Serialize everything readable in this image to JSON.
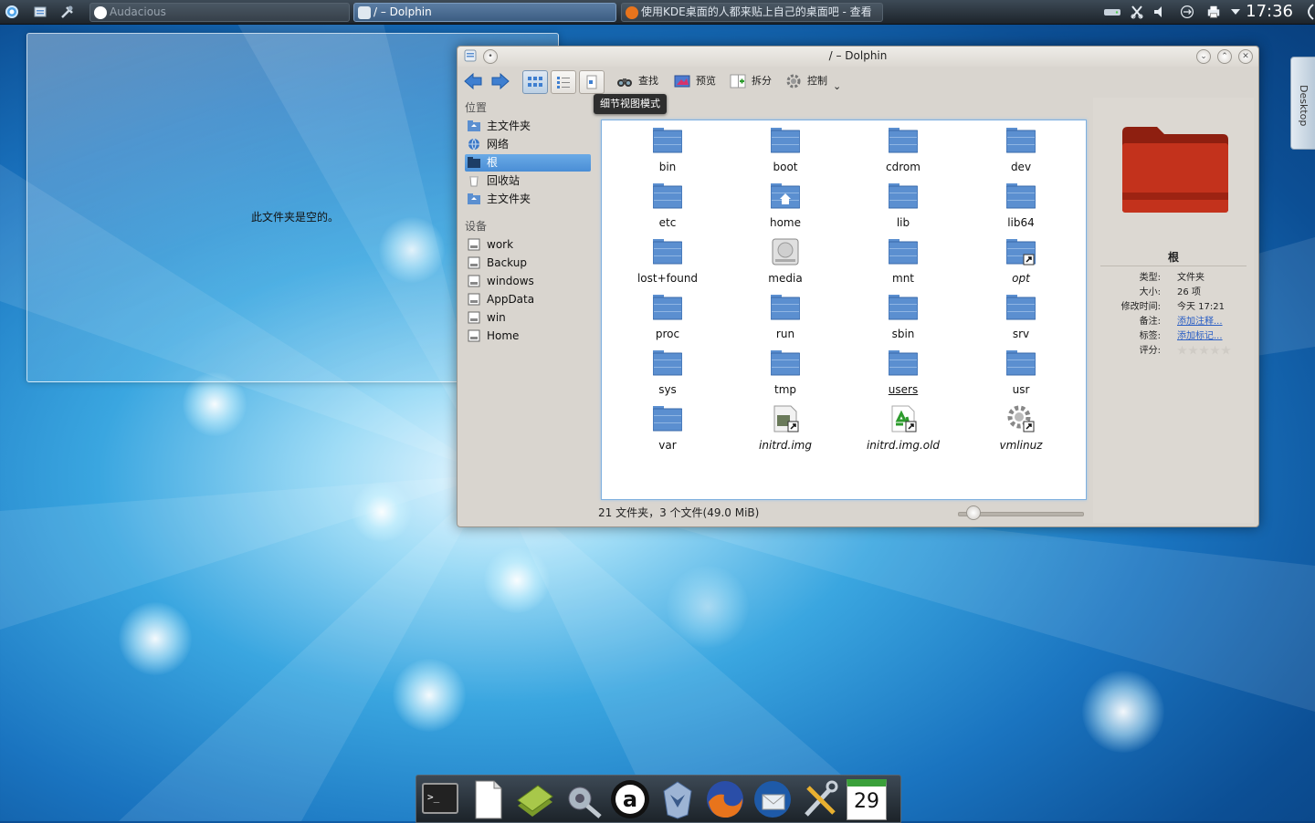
{
  "top_panel": {
    "tasks": [
      {
        "label": "Audacious",
        "icon": "audacious-icon",
        "state": "inactive"
      },
      {
        "label": "/ – Dolphin",
        "icon": "dolphin-icon",
        "state": "active"
      },
      {
        "label": "使用KDE桌面的人都来贴上自己的桌面吧 - 查看",
        "icon": "firefox-icon",
        "state": "inactive"
      }
    ],
    "clock": "17:36"
  },
  "empty_window": {
    "message": "此文件夹是空的。"
  },
  "dolphin": {
    "title": "/ – Dolphin",
    "toolbar": {
      "find_label": "查找",
      "preview_label": "预览",
      "split_label": "拆分",
      "control_label": "控制"
    },
    "tooltip": "细节视图模式",
    "places": {
      "section_places": "位置",
      "places_items": [
        {
          "label": "主文件夹",
          "icon": "home-folder-icon"
        },
        {
          "label": "网络",
          "icon": "network-icon"
        },
        {
          "label": "根",
          "icon": "root-folder-icon",
          "selected": true
        },
        {
          "label": "回收站",
          "icon": "trash-icon"
        },
        {
          "label": "主文件夹",
          "icon": "home-folder-icon"
        }
      ],
      "section_devices": "设备",
      "devices": [
        {
          "label": "work",
          "icon": "drive-icon"
        },
        {
          "label": "Backup",
          "icon": "drive-icon"
        },
        {
          "label": "windows",
          "icon": "drive-icon"
        },
        {
          "label": "AppData",
          "icon": "drive-icon"
        },
        {
          "label": "win",
          "icon": "drive-icon"
        },
        {
          "label": "Home",
          "icon": "drive-icon"
        }
      ]
    },
    "files": [
      {
        "name": "bin",
        "type": "folder"
      },
      {
        "name": "boot",
        "type": "folder"
      },
      {
        "name": "cdrom",
        "type": "folder"
      },
      {
        "name": "dev",
        "type": "folder"
      },
      {
        "name": "etc",
        "type": "folder"
      },
      {
        "name": "home",
        "type": "home-folder"
      },
      {
        "name": "lib",
        "type": "folder"
      },
      {
        "name": "lib64",
        "type": "folder"
      },
      {
        "name": "lost+found",
        "type": "folder"
      },
      {
        "name": "media",
        "type": "drive"
      },
      {
        "name": "mnt",
        "type": "folder"
      },
      {
        "name": "opt",
        "type": "link-folder",
        "italic": true
      },
      {
        "name": "proc",
        "type": "folder"
      },
      {
        "name": "run",
        "type": "folder"
      },
      {
        "name": "sbin",
        "type": "folder"
      },
      {
        "name": "srv",
        "type": "folder"
      },
      {
        "name": "sys",
        "type": "folder"
      },
      {
        "name": "tmp",
        "type": "folder"
      },
      {
        "name": "users",
        "type": "folder",
        "underline": true
      },
      {
        "name": "usr",
        "type": "folder"
      },
      {
        "name": "var",
        "type": "folder"
      },
      {
        "name": "initrd.img",
        "type": "link-file",
        "italic": true
      },
      {
        "name": "initrd.img.old",
        "type": "link-recycle",
        "italic": true
      },
      {
        "name": "vmlinuz",
        "type": "link-gear",
        "italic": true
      }
    ],
    "status": "21 文件夹，3 个文件(49.0 MiB)",
    "info_panel": {
      "name": "根",
      "rows": [
        {
          "key": "类型:",
          "value": "文件夹"
        },
        {
          "key": "大小:",
          "value": "26 项"
        },
        {
          "key": "修改时间:",
          "value": "今天 17:21"
        },
        {
          "key": "备注:",
          "value": "添加注释...",
          "link": true
        },
        {
          "key": "标签:",
          "value": "添加标记...",
          "link": true
        }
      ],
      "rating_label": "评分:",
      "rating": 0
    },
    "colors": {
      "folder": "#5b8fd0",
      "selection": "#4a8ed6",
      "big_folder": "#c0301c"
    }
  },
  "desktop_tab": "Desktop",
  "dock": {
    "icons": [
      "terminal-icon",
      "text-editor-icon",
      "dictionary-icon",
      "system-settings-icon",
      "audacious-icon",
      "transformers-icon",
      "firefox-icon",
      "thunderbird-icon",
      "tools-icon",
      "calendar-icon"
    ],
    "calendar_day": "29"
  }
}
